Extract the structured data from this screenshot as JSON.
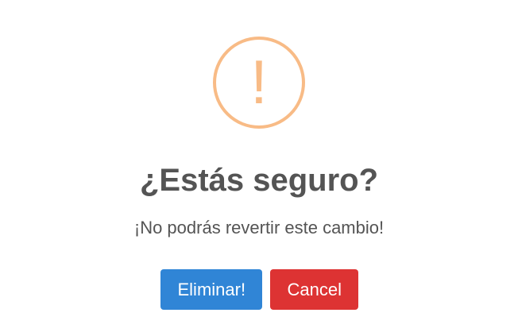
{
  "dialog": {
    "icon": "warning-exclamation-icon",
    "icon_glyph": "!",
    "icon_color": "#f8bb86",
    "title": "¿Estás seguro?",
    "message": "¡No podrás revertir este cambio!",
    "confirm_label": "Eliminar!",
    "cancel_label": "Cancel",
    "confirm_color": "#3085d6",
    "cancel_color": "#dd3333"
  }
}
